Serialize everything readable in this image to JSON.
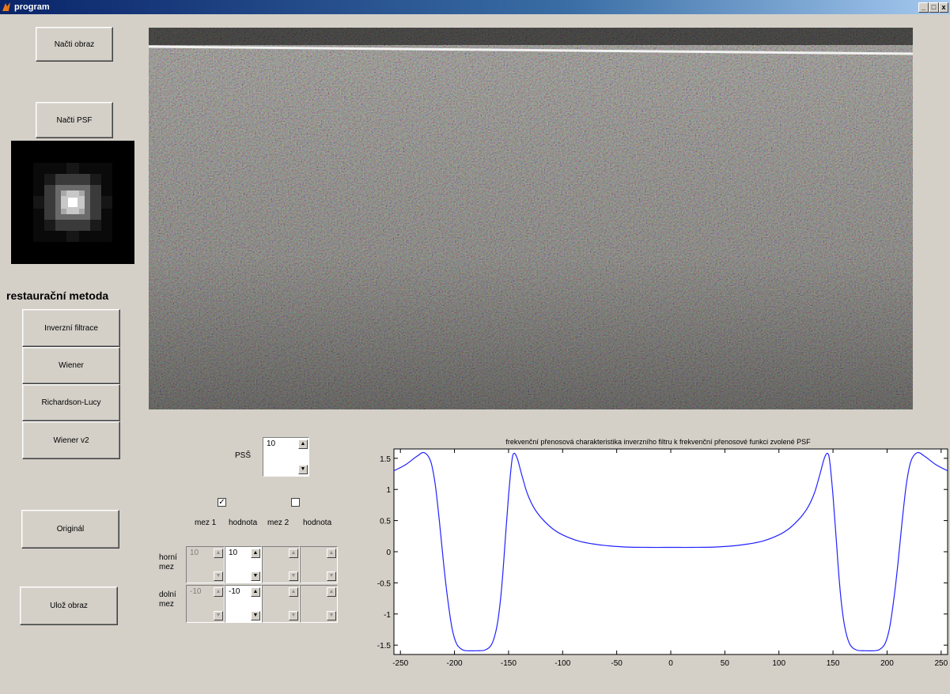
{
  "window": {
    "title": "program"
  },
  "buttons": {
    "load_image": "Načti obraz",
    "load_psf": "Načti PSF",
    "original": "Originál",
    "save_image": "Ulož obraz"
  },
  "methods": {
    "heading": "restaurační metoda",
    "items": [
      "Inverzní filtrace",
      "Wiener",
      "Richardson-Lucy",
      "Wiener v2"
    ]
  },
  "psnr": {
    "label": "PSŠ",
    "value": "10"
  },
  "limits": {
    "mez1_checked": true,
    "mez2_checked": false,
    "headers": [
      "mez 1",
      "hodnota",
      "mez 2",
      "hodnota"
    ],
    "rows": [
      {
        "label": "horní mez",
        "values": [
          "10",
          "10",
          "",
          ""
        ]
      },
      {
        "label": "dolní mez",
        "values": [
          "-10",
          "-10",
          "",
          ""
        ]
      }
    ]
  },
  "chart_data": {
    "type": "line",
    "title": "frekvenční přenosová charakteristika inverzního filtru k frekvenční přenosové funkci zvolené PSF",
    "xlim": [
      -256,
      256
    ],
    "ylim": [
      -1.65,
      1.65
    ],
    "xticks": [
      -250,
      -200,
      -150,
      -100,
      -50,
      0,
      50,
      100,
      150,
      200,
      250
    ],
    "yticks": [
      1.5,
      1,
      0.5,
      0,
      -0.5,
      -1,
      -1.5
    ],
    "color": "#2222ff",
    "x": [
      -256,
      -245,
      -235,
      -228,
      -222,
      -218,
      -214,
      -210,
      -206,
      -202,
      -198,
      -193,
      -188,
      -180,
      -172,
      -166,
      -162,
      -159,
      -156,
      -153,
      -150,
      -147,
      -145,
      -142,
      -138,
      -133,
      -127,
      -120,
      -110,
      -100,
      -85,
      -70,
      -55,
      -40,
      -20,
      0,
      20,
      40,
      55,
      70,
      85,
      100,
      110,
      120,
      127,
      133,
      138,
      142,
      145,
      147,
      150,
      153,
      156,
      159,
      162,
      166,
      172,
      180,
      188,
      193,
      198,
      202,
      206,
      210,
      214,
      218,
      222,
      228,
      235,
      245,
      256
    ],
    "y": [
      1.3,
      1.4,
      1.53,
      1.59,
      1.45,
      1.1,
      0.5,
      -0.2,
      -0.8,
      -1.25,
      -1.48,
      -1.57,
      -1.59,
      -1.59,
      -1.58,
      -1.5,
      -1.3,
      -1.0,
      -0.5,
      0.2,
      0.9,
      1.45,
      1.58,
      1.5,
      1.25,
      0.95,
      0.72,
      0.55,
      0.38,
      0.27,
      0.17,
      0.12,
      0.09,
      0.075,
      0.07,
      0.07,
      0.07,
      0.075,
      0.09,
      0.12,
      0.17,
      0.27,
      0.38,
      0.55,
      0.72,
      0.95,
      1.25,
      1.5,
      1.58,
      1.45,
      0.9,
      0.2,
      -0.5,
      -1.0,
      -1.3,
      -1.5,
      -1.58,
      -1.59,
      -1.59,
      -1.57,
      -1.48,
      -1.25,
      -0.8,
      -0.2,
      0.5,
      1.1,
      1.45,
      1.59,
      1.53,
      1.4,
      1.3
    ]
  }
}
